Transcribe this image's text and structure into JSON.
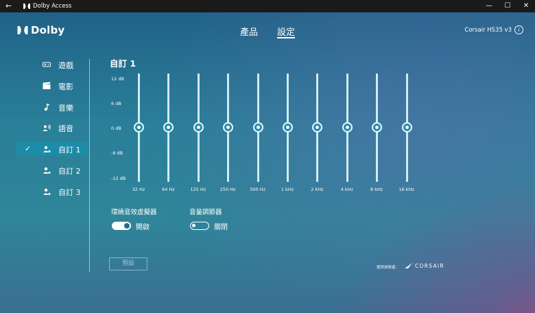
{
  "window": {
    "title": "Dolby Access",
    "back_icon": "←",
    "minimize": "—",
    "maximize": "☐",
    "close": "✕"
  },
  "brand": {
    "logo_text": "Dolby"
  },
  "nav": {
    "tabs": [
      {
        "label": "產品",
        "active": false
      },
      {
        "label": "設定",
        "active": true
      }
    ],
    "device": "Corsair HS35 v3",
    "info_icon": "i"
  },
  "sidebar": {
    "items": [
      {
        "label": "遊戲",
        "icon": "gamepad-icon"
      },
      {
        "label": "電影",
        "icon": "clapperboard-icon"
      },
      {
        "label": "音樂",
        "icon": "music-note-icon"
      },
      {
        "label": "語音",
        "icon": "voice-icon"
      },
      {
        "label": "自訂 1",
        "icon": "custom-profile-icon",
        "selected": true,
        "check": "✓"
      },
      {
        "label": "自訂 2",
        "icon": "custom-profile-icon"
      },
      {
        "label": "自訂 3",
        "icon": "custom-profile-icon"
      }
    ]
  },
  "equalizer": {
    "title": "自訂 1",
    "db_labels": [
      "12 dB",
      "6 dB",
      "0 dB",
      "-6 dB",
      "-12 dB"
    ],
    "range_db": [
      -12,
      12
    ],
    "bands": [
      {
        "freq": "32 Hz",
        "gain_db": 0
      },
      {
        "freq": "64 Hz",
        "gain_db": 0
      },
      {
        "freq": "125 Hz",
        "gain_db": 0
      },
      {
        "freq": "250 Hz",
        "gain_db": 0
      },
      {
        "freq": "500 Hz",
        "gain_db": 0
      },
      {
        "freq": "1 kHz",
        "gain_db": 0
      },
      {
        "freq": "2 kHz",
        "gain_db": 0
      },
      {
        "freq": "4 kHz",
        "gain_db": 0
      },
      {
        "freq": "8 kHz",
        "gain_db": 0
      },
      {
        "freq": "16 kHz",
        "gain_db": 0
      }
    ]
  },
  "toggles": {
    "virtualizer": {
      "label": "環繞音效虛擬器",
      "state": "開啟",
      "on": true
    },
    "volume_leveler": {
      "label": "音量調節器",
      "state": "關閉",
      "on": false
    }
  },
  "preset_button": "預設",
  "footer": {
    "provided_by": "提供技術者：",
    "partner": "CORSAIR"
  },
  "colors": {
    "selected_item": "#1c8ca8",
    "titlebar": "#1a1a1a"
  }
}
